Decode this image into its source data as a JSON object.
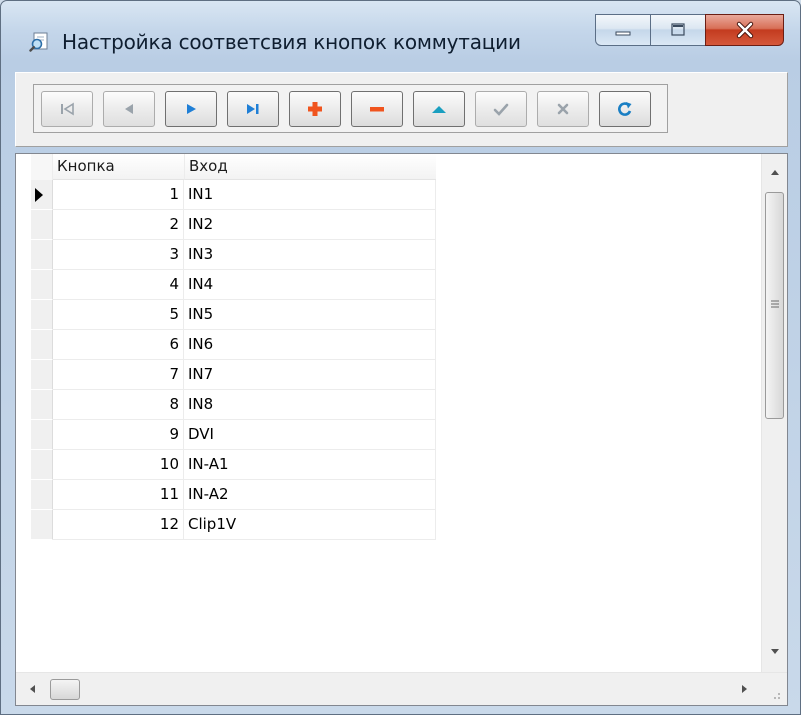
{
  "window": {
    "title": "Настройка соответсвия кнопок коммутации",
    "app_icon": "magnifier-document-icon",
    "caption_buttons": [
      "minimize-icon",
      "maximize-icon",
      "close-icon"
    ]
  },
  "navigator": {
    "buttons": [
      {
        "name": "first",
        "icon": "first-record-icon",
        "enabled": false
      },
      {
        "name": "prior",
        "icon": "prior-record-icon",
        "enabled": false
      },
      {
        "name": "next",
        "icon": "next-record-icon",
        "enabled": true
      },
      {
        "name": "last",
        "icon": "last-record-icon",
        "enabled": true
      },
      {
        "name": "insert",
        "icon": "plus-icon",
        "enabled": true
      },
      {
        "name": "delete",
        "icon": "minus-icon",
        "enabled": true
      },
      {
        "name": "edit",
        "icon": "up-triangle-icon",
        "enabled": true
      },
      {
        "name": "post",
        "icon": "checkmark-icon",
        "enabled": false
      },
      {
        "name": "cancel",
        "icon": "cross-icon",
        "enabled": false
      },
      {
        "name": "refresh",
        "icon": "refresh-icon",
        "enabled": true
      }
    ],
    "colors": {
      "blue": "#1f7fd6",
      "orange": "#f0541e",
      "teal": "#1a9fc0",
      "disabled": "#9aa3ab"
    }
  },
  "grid": {
    "columns": [
      "Кнопка",
      "Вход"
    ],
    "current_row": 0,
    "rows": [
      {
        "button": "1",
        "input": "IN1"
      },
      {
        "button": "2",
        "input": "IN2"
      },
      {
        "button": "3",
        "input": "IN3"
      },
      {
        "button": "4",
        "input": "IN4"
      },
      {
        "button": "5",
        "input": "IN5"
      },
      {
        "button": "6",
        "input": "IN6"
      },
      {
        "button": "7",
        "input": "IN7"
      },
      {
        "button": "8",
        "input": "IN8"
      },
      {
        "button": "9",
        "input": "DVI"
      },
      {
        "button": "10",
        "input": "IN-A1"
      },
      {
        "button": "11",
        "input": "IN-A2"
      },
      {
        "button": "12",
        "input": "Clip1V"
      }
    ]
  }
}
